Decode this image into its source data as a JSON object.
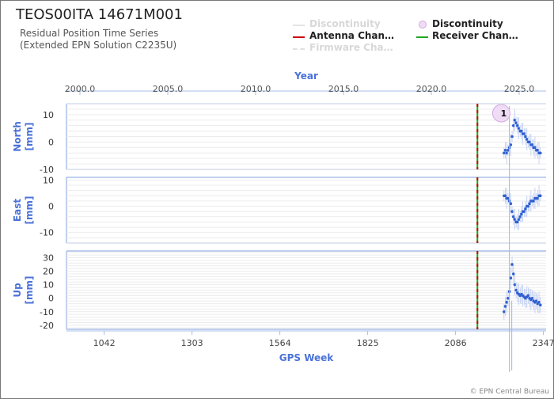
{
  "header": {
    "title": "TEOS00ITA 14671M001",
    "subtitle_line1": "Residual Position Time Series",
    "subtitle_line2": "(Extended EPN Solution C2235U)"
  },
  "legend": {
    "items": [
      {
        "label": "Discontinuity",
        "style": "line",
        "color": "#e0e0e0",
        "faded": true
      },
      {
        "label": "Discontinuity",
        "style": "dot",
        "color": "#e8c8f0",
        "faded": false
      },
      {
        "label": "Antenna Chan…",
        "style": "line",
        "color": "#d00000",
        "faded": false
      },
      {
        "label": "Receiver Chan…",
        "style": "line",
        "color": "#1fa81f",
        "faded": false
      },
      {
        "label": "Firmware Cha…",
        "style": "dashed",
        "color": "#e0e0e0",
        "faded": true
      }
    ]
  },
  "credit": "© EPN Central Bureau",
  "chart_data": {
    "type": "scatter",
    "x_label_top": "Year",
    "x_label_bottom": "GPS Week",
    "x_ticks_bottom": [
      1042,
      1303,
      1564,
      1825,
      2086,
      2347
    ],
    "x_ticks_top": [
      "2000.0",
      "2005.0",
      "2010.0",
      "2015.0",
      "2020.0",
      "2025.0"
    ],
    "xlim_gps_week": [
      930,
      2355
    ],
    "grid": true,
    "equipment_change_gps_week": 2151,
    "discontinuity_marker": {
      "gps_week": 2222,
      "label": "1"
    },
    "series_color": "#3060d0",
    "panels": [
      {
        "name": "North",
        "unit": "[mm]",
        "ylim": [
          -10,
          14
        ],
        "yticks": [
          10,
          0,
          -10
        ],
        "tick_labels": [
          "10",
          "0",
          "-10"
        ],
        "points": [
          [
            2230,
            -4
          ],
          [
            2234,
            -3
          ],
          [
            2238,
            -4
          ],
          [
            2242,
            -3
          ],
          [
            2246,
            -2
          ],
          [
            2250,
            -1
          ],
          [
            2254,
            2
          ],
          [
            2258,
            6
          ],
          [
            2262,
            8
          ],
          [
            2266,
            7
          ],
          [
            2270,
            6
          ],
          [
            2274,
            5
          ],
          [
            2278,
            4
          ],
          [
            2282,
            4
          ],
          [
            2286,
            3
          ],
          [
            2290,
            3
          ],
          [
            2294,
            2
          ],
          [
            2298,
            1
          ],
          [
            2302,
            0
          ],
          [
            2306,
            0
          ],
          [
            2310,
            -1
          ],
          [
            2314,
            -1
          ],
          [
            2318,
            -2
          ],
          [
            2322,
            -2
          ],
          [
            2326,
            -3
          ],
          [
            2330,
            -3
          ],
          [
            2334,
            -4
          ],
          [
            2338,
            -4
          ]
        ]
      },
      {
        "name": "East",
        "unit": "[mm]",
        "ylim": [
          -14,
          11
        ],
        "yticks": [
          10,
          0,
          -10
        ],
        "tick_labels": [
          "10",
          "0",
          "-10"
        ],
        "points": [
          [
            2230,
            4
          ],
          [
            2234,
            4
          ],
          [
            2238,
            3
          ],
          [
            2242,
            3
          ],
          [
            2246,
            2
          ],
          [
            2250,
            1
          ],
          [
            2254,
            -2
          ],
          [
            2258,
            -4
          ],
          [
            2262,
            -5
          ],
          [
            2266,
            -6
          ],
          [
            2270,
            -6
          ],
          [
            2274,
            -5
          ],
          [
            2278,
            -4
          ],
          [
            2282,
            -3
          ],
          [
            2286,
            -2
          ],
          [
            2290,
            -2
          ],
          [
            2294,
            -1
          ],
          [
            2298,
            0
          ],
          [
            2302,
            0
          ],
          [
            2306,
            1
          ],
          [
            2310,
            2
          ],
          [
            2314,
            2
          ],
          [
            2318,
            2
          ],
          [
            2322,
            3
          ],
          [
            2326,
            3
          ],
          [
            2330,
            3
          ],
          [
            2334,
            4
          ],
          [
            2338,
            4
          ]
        ]
      },
      {
        "name": "Up",
        "unit": "[mm]",
        "ylim": [
          -23,
          35
        ],
        "yticks": [
          30,
          20,
          10,
          0,
          -10,
          -20
        ],
        "tick_labels": [
          "30",
          "20",
          "10",
          "0",
          "-10",
          "-20"
        ],
        "points": [
          [
            2230,
            -10
          ],
          [
            2234,
            -6
          ],
          [
            2238,
            -3
          ],
          [
            2242,
            0
          ],
          [
            2246,
            5
          ],
          [
            2250,
            15
          ],
          [
            2254,
            25
          ],
          [
            2258,
            18
          ],
          [
            2262,
            10
          ],
          [
            2266,
            6
          ],
          [
            2270,
            4
          ],
          [
            2274,
            3
          ],
          [
            2278,
            2
          ],
          [
            2282,
            3
          ],
          [
            2286,
            2
          ],
          [
            2290,
            1
          ],
          [
            2294,
            0
          ],
          [
            2298,
            1
          ],
          [
            2302,
            2
          ],
          [
            2306,
            0
          ],
          [
            2310,
            -1
          ],
          [
            2314,
            0
          ],
          [
            2318,
            -2
          ],
          [
            2322,
            -3
          ],
          [
            2326,
            -2
          ],
          [
            2330,
            -4
          ],
          [
            2334,
            -3
          ],
          [
            2338,
            -5
          ]
        ]
      }
    ]
  }
}
